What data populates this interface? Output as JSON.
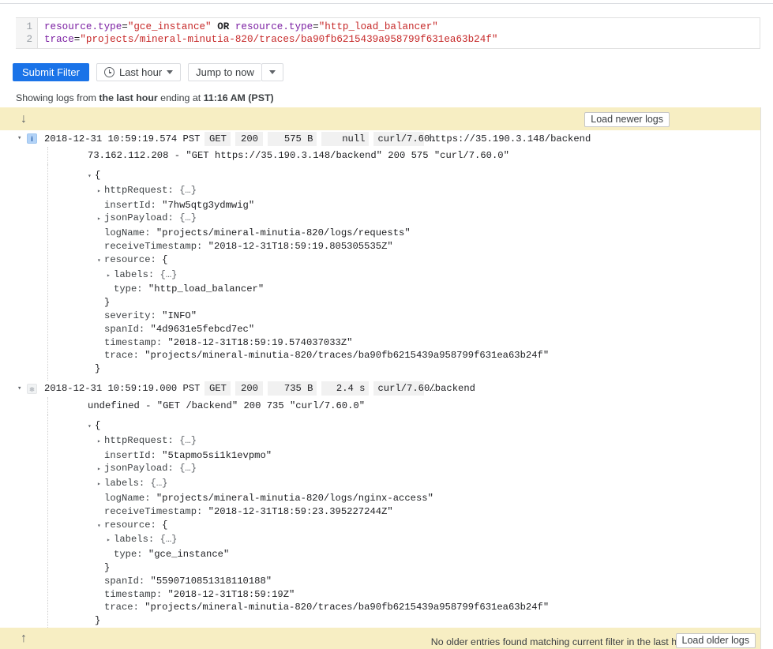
{
  "editor": {
    "lines": [
      {
        "num": "1",
        "tokens": [
          {
            "t": "field",
            "v": "resource.type"
          },
          {
            "t": "eq",
            "v": "="
          },
          {
            "t": "str",
            "v": "\"gce_instance\""
          },
          {
            "t": "plain",
            "v": " "
          },
          {
            "t": "op",
            "v": "OR"
          },
          {
            "t": "plain",
            "v": " "
          },
          {
            "t": "field",
            "v": "resource.type"
          },
          {
            "t": "eq",
            "v": "="
          },
          {
            "t": "str",
            "v": "\"http_load_balancer\""
          }
        ]
      },
      {
        "num": "2",
        "tokens": [
          {
            "t": "field",
            "v": "trace"
          },
          {
            "t": "eq",
            "v": "="
          },
          {
            "t": "str",
            "v": "\"projects/mineral-minutia-820/traces/ba90fb6215439a958799f631ea63b24f\""
          }
        ]
      }
    ]
  },
  "toolbar": {
    "submit_label": "Submit Filter",
    "range_label": "Last hour",
    "range_icon": "clock-icon",
    "jump_label": "Jump to now",
    "caret_icon": "chevron-down-icon"
  },
  "status": {
    "prefix": "Showing logs from ",
    "range": "the last hour",
    "middle": " ending at ",
    "time": "11:16 AM (PST)"
  },
  "newer_bar": {
    "arrow": "↓",
    "arrow_icon": "arrow-down-icon",
    "button_label": "Load newer logs"
  },
  "older_bar": {
    "arrow": "↑",
    "arrow_icon": "arrow-up-icon",
    "text": "No older entries found matching current filter in the last hour",
    "button_label": "Load older logs"
  },
  "entries": [
    {
      "twisty": "▾",
      "severity_icon": "info-icon",
      "severity_glyph": "i",
      "severity_class": "sev-info",
      "timestamp": "2018-12-31 10:59:19.574 PST",
      "method": "GET",
      "status": "200",
      "size": "575 B",
      "latency": "null",
      "agent": "curl/7.60…",
      "url": "https://35.190.3.148/backend",
      "raw": "73.162.112.208 - \"GET https://35.190.3.148/backend\" 200 575 \"curl/7.60.0\"",
      "json_rows": [
        {
          "indent": 0,
          "twisty": "▾",
          "key": "",
          "text": "{"
        },
        {
          "indent": 1,
          "twisty": "▸",
          "key": "httpRequest: ",
          "text": "{…}"
        },
        {
          "indent": 1,
          "twisty": "",
          "key": "insertId: ",
          "text": "\"7hw5qtg3ydmwig\""
        },
        {
          "indent": 1,
          "twisty": "▸",
          "key": "jsonPayload: ",
          "text": "{…}"
        },
        {
          "indent": 1,
          "twisty": "",
          "key": "logName: ",
          "text": "\"projects/mineral-minutia-820/logs/requests\""
        },
        {
          "indent": 1,
          "twisty": "",
          "key": "receiveTimestamp: ",
          "text": "\"2018-12-31T18:59:19.805305535Z\""
        },
        {
          "indent": 1,
          "twisty": "▾",
          "key": "resource: ",
          "text": "{"
        },
        {
          "indent": 2,
          "twisty": "▸",
          "key": "labels: ",
          "text": "{…}"
        },
        {
          "indent": 2,
          "twisty": "",
          "key": "type: ",
          "text": "\"http_load_balancer\""
        },
        {
          "indent": 1,
          "twisty": "",
          "key": "",
          "text": "}"
        },
        {
          "indent": 1,
          "twisty": "",
          "key": "severity: ",
          "text": "\"INFO\""
        },
        {
          "indent": 1,
          "twisty": "",
          "key": "spanId: ",
          "text": "\"4d9631e5febcd7ec\""
        },
        {
          "indent": 1,
          "twisty": "",
          "key": "timestamp: ",
          "text": "\"2018-12-31T18:59:19.574037033Z\""
        },
        {
          "indent": 1,
          "twisty": "",
          "key": "trace: ",
          "text": "\"projects/mineral-minutia-820/traces/ba90fb6215439a958799f631ea63b24f\""
        },
        {
          "indent": 0,
          "twisty": "",
          "key": "",
          "text": "}"
        }
      ]
    },
    {
      "twisty": "▾",
      "severity_icon": "default-severity-icon",
      "severity_glyph": "✱",
      "severity_class": "sev-default",
      "timestamp": "2018-12-31 10:59:19.000 PST",
      "method": "GET",
      "status": "200",
      "size": "735 B",
      "latency": "2.4 s",
      "agent": "curl/7.60…",
      "url": "/backend",
      "raw": "undefined - \"GET /backend\" 200 735 \"curl/7.60.0\"",
      "json_rows": [
        {
          "indent": 0,
          "twisty": "▾",
          "key": "",
          "text": "{"
        },
        {
          "indent": 1,
          "twisty": "▸",
          "key": "httpRequest: ",
          "text": "{…}"
        },
        {
          "indent": 1,
          "twisty": "",
          "key": "insertId: ",
          "text": "\"5tapmo5si1k1evpmo\""
        },
        {
          "indent": 1,
          "twisty": "▸",
          "key": "jsonPayload: ",
          "text": "{…}"
        },
        {
          "indent": 1,
          "twisty": "▸",
          "key": "labels: ",
          "text": "{…}"
        },
        {
          "indent": 1,
          "twisty": "",
          "key": "logName: ",
          "text": "\"projects/mineral-minutia-820/logs/nginx-access\""
        },
        {
          "indent": 1,
          "twisty": "",
          "key": "receiveTimestamp: ",
          "text": "\"2018-12-31T18:59:23.395227244Z\""
        },
        {
          "indent": 1,
          "twisty": "▾",
          "key": "resource: ",
          "text": "{"
        },
        {
          "indent": 2,
          "twisty": "▸",
          "key": "labels: ",
          "text": "{…}"
        },
        {
          "indent": 2,
          "twisty": "",
          "key": "type: ",
          "text": "\"gce_instance\""
        },
        {
          "indent": 1,
          "twisty": "",
          "key": "",
          "text": "}"
        },
        {
          "indent": 1,
          "twisty": "",
          "key": "spanId: ",
          "text": "\"5590710851318110188\""
        },
        {
          "indent": 1,
          "twisty": "",
          "key": "timestamp: ",
          "text": "\"2018-12-31T18:59:19Z\""
        },
        {
          "indent": 1,
          "twisty": "",
          "key": "trace: ",
          "text": "\"projects/mineral-minutia-820/traces/ba90fb6215439a958799f631ea63b24f\""
        },
        {
          "indent": 0,
          "twisty": "",
          "key": "",
          "text": "}"
        }
      ]
    }
  ],
  "colors": {
    "accent": "#1a73e8",
    "bar": "#f7eec3",
    "chip": "#f1f1f1",
    "field": "#7b1fa2",
    "string": "#c62828"
  }
}
